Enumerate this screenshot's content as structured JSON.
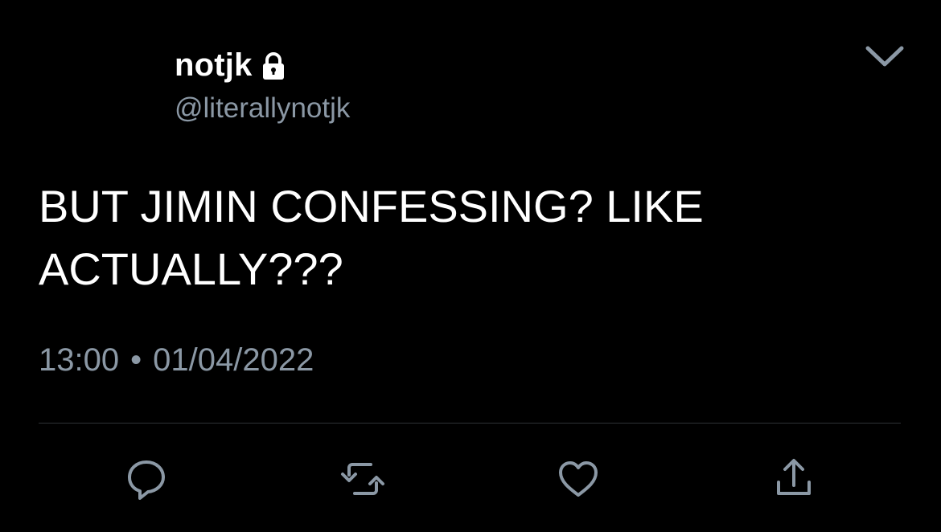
{
  "tweet": {
    "author": {
      "display_name": "notjk",
      "handle": "@literallynotjk",
      "protected_icon": "lock-icon"
    },
    "text": "BUT JIMIN CONFESSING? LIKE ACTUALLY???",
    "time": "13:00",
    "separator": "•",
    "date": "01/04/2022"
  },
  "menu": {
    "icon": "chevron-down-icon"
  },
  "actions": [
    {
      "name": "reply",
      "icon": "speech-bubble-icon"
    },
    {
      "name": "retweet",
      "icon": "retweet-arrows-icon"
    },
    {
      "name": "like",
      "icon": "heart-icon"
    },
    {
      "name": "share",
      "icon": "share-upload-icon"
    }
  ],
  "colors": {
    "background": "#000000",
    "primary_text": "#ffffff",
    "secondary_text": "#8b98a5",
    "divider": "#2f3336",
    "icon": "#8b98a5"
  }
}
